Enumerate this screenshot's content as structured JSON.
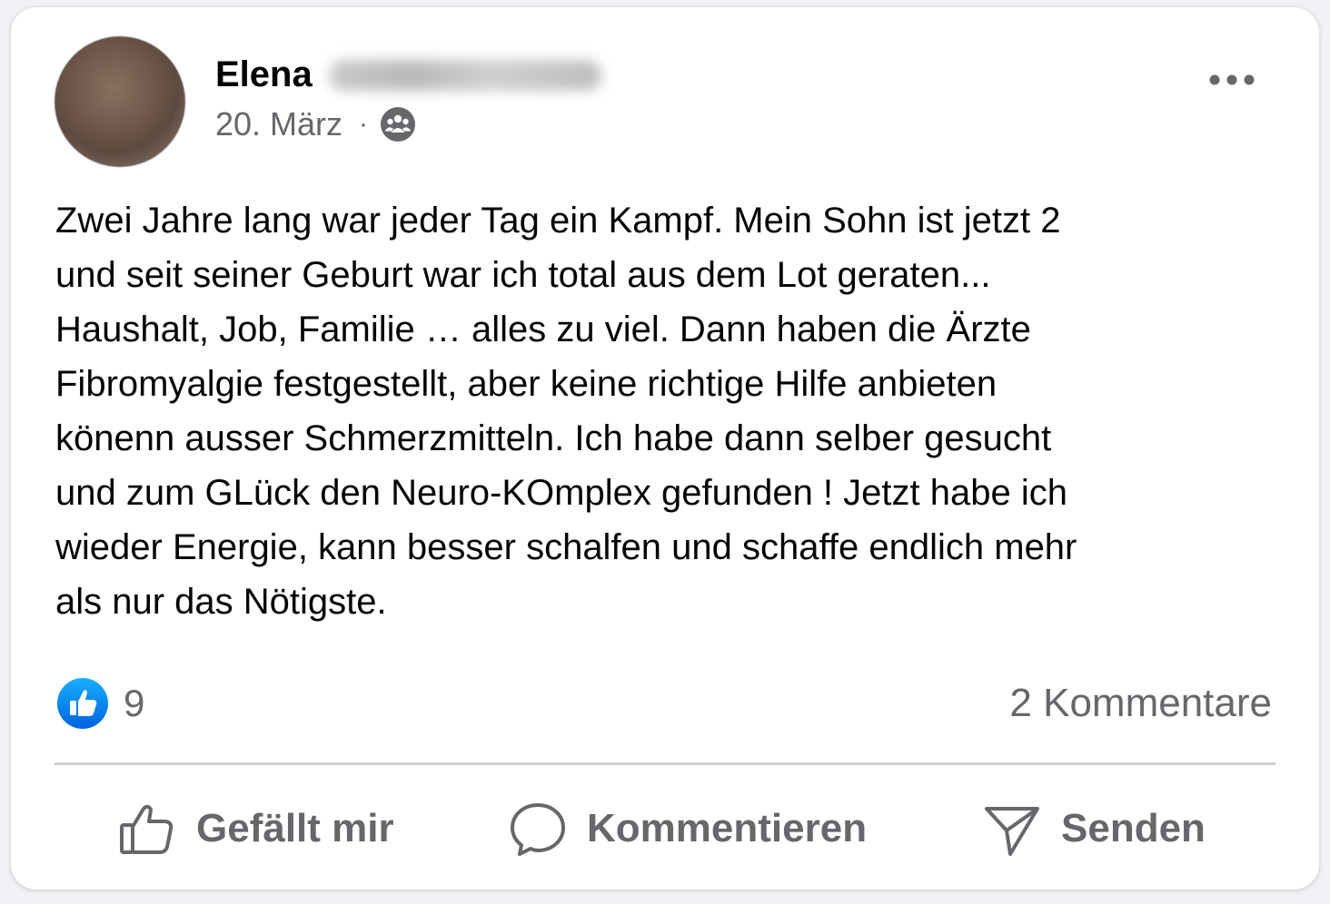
{
  "post": {
    "author_first_name": "Elena",
    "date": "20. März",
    "separator": "·",
    "audience_icon": "friends-icon",
    "more_icon": "more-horizontal-icon",
    "text": "Zwei Jahre lang war jeder Tag ein Kampf. Mein Sohn ist jetzt 2\nund seit seiner Geburt war ich total aus dem Lot geraten...\nHaushalt, Job, Familie … alles zu viel. Dann haben die Ärzte\nFibromyalgie festgestellt, aber keine richtige Hilfe anbieten\nkönenn ausser Schmerzmitteln. Ich habe dann selber gesucht\nund zum GLück den Neuro-KOmplex gefunden ! Jetzt habe ich\nwieder Energie, kann besser schalfen und schaffe endlich mehr\nals nur das Nötigste."
  },
  "stats": {
    "like_icon": "like-reaction-icon",
    "likes": "9",
    "comments": "2 Kommentare"
  },
  "actions": {
    "like_label": "Gefällt mir",
    "comment_label": "Kommentieren",
    "send_label": "Senden"
  },
  "colors": {
    "brand_blue": "#1877f2",
    "secondary_text": "#65676b",
    "primary_text": "#050505",
    "divider": "#ced0d4"
  }
}
